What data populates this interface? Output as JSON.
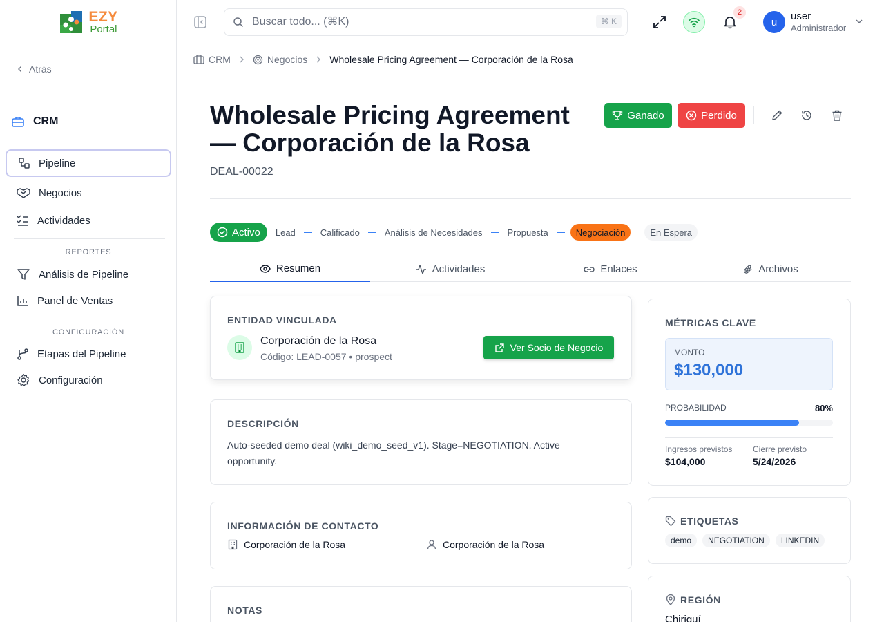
{
  "brand": {
    "line1": "EZY",
    "line2": "Portal"
  },
  "sidebar": {
    "back_label": "Atrás",
    "module_title": "CRM",
    "items": [
      {
        "label": "Pipeline"
      },
      {
        "label": "Negocios"
      },
      {
        "label": "Actividades"
      }
    ],
    "reports_section": "REPORTES",
    "reports": [
      {
        "label": "Análisis de Pipeline"
      },
      {
        "label": "Panel de Ventas"
      }
    ],
    "config_section": "CONFIGURACIÓN",
    "config": [
      {
        "label": "Etapas del Pipeline"
      },
      {
        "label": "Configuración"
      }
    ]
  },
  "topbar": {
    "search_placeholder": "Buscar todo... (⌘K)",
    "shortcut": "⌘ K",
    "notification_count": "2",
    "user_initial": "u",
    "user_name": "user",
    "user_role": "Administrador"
  },
  "breadcrumb": {
    "crm": "CRM",
    "deals": "Negocios",
    "current": "Wholesale Pricing Agreement — Corporación de la Rosa"
  },
  "deal": {
    "title": "Wholesale Pricing Agreement — Corporación de la Rosa",
    "id": "DEAL-00022",
    "won_label": "Ganado",
    "lost_label": "Perdido"
  },
  "stages": {
    "status": "Activo",
    "items": [
      "Lead",
      "Calificado",
      "Análisis de Necesidades",
      "Propuesta"
    ],
    "current": "Negociación",
    "on_hold": "En Espera"
  },
  "tabs": [
    {
      "label": "Resumen"
    },
    {
      "label": "Actividades"
    },
    {
      "label": "Enlaces"
    },
    {
      "label": "Archivos"
    }
  ],
  "entity": {
    "heading": "ENTIDAD VINCULADA",
    "name": "Corporación de la Rosa",
    "sub": "Código: LEAD-0057 • prospect",
    "button": "Ver Socio de Negocio"
  },
  "description": {
    "heading": "DESCRIPCIÓN",
    "text": "Auto-seeded demo deal (wiki_demo_seed_v1). Stage=NEGOTIATION. Active opportunity."
  },
  "contact": {
    "heading": "INFORMACIÓN DE CONTACTO",
    "company": "Corporación de la Rosa",
    "person": "Corporación de la Rosa"
  },
  "notes": {
    "heading": "NOTAS"
  },
  "metrics": {
    "heading": "MÉTRICAS CLAVE",
    "amount_label": "MONTO",
    "amount_value": "$130,000",
    "probability_label": "PROBABILIDAD",
    "probability_value": "80%",
    "probability_fraction": 0.8,
    "expected_label": "Ingresos previstos",
    "expected_value": "$104,000",
    "close_label": "Cierre previsto",
    "close_value": "5/24/2026"
  },
  "tags": {
    "heading": "ETIQUETAS",
    "items": [
      "demo",
      "NEGOTIATION",
      "LINKEDIN"
    ]
  },
  "region": {
    "heading": "REGIÓN",
    "value": "Chiriquí"
  },
  "colors": {
    "primary_green": "#16a34a",
    "danger_red": "#ef4444",
    "accent_blue": "#3b82f6",
    "current_stage_orange": "#f97316"
  }
}
